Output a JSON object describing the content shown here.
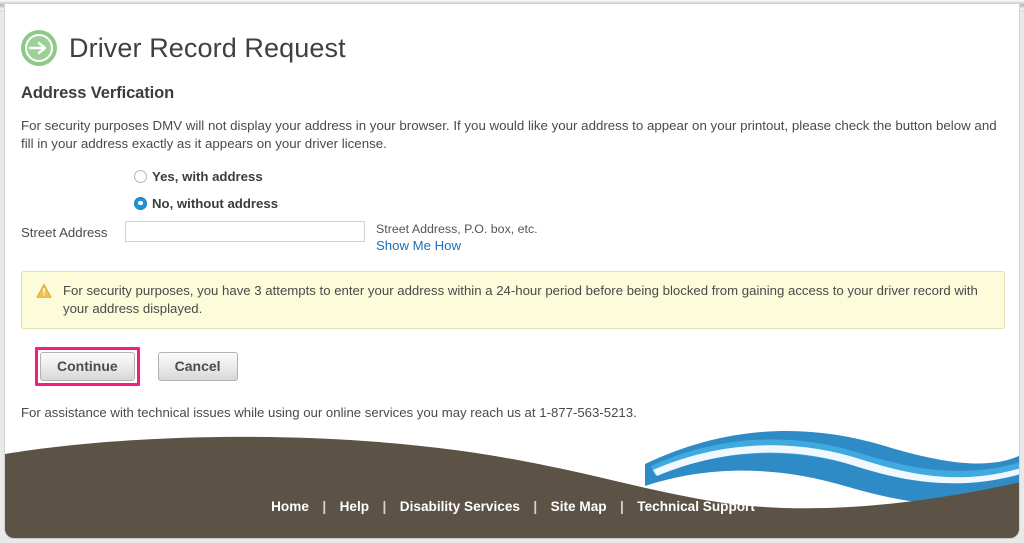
{
  "header": {
    "icon": "green-arrow-circle-icon",
    "title": "Driver Record Request"
  },
  "section": {
    "heading": "Address Verfication",
    "intro": "For security purposes DMV will not display your address in your browser. If you would like your address to appear on your printout, please check the button below and fill in your address exactly as it appears on your driver license."
  },
  "form": {
    "options": [
      {
        "label": "Yes, with address",
        "selected": false
      },
      {
        "label": "No, without address",
        "selected": true
      }
    ],
    "street_address": {
      "label": "Street Address",
      "value": "",
      "placeholder": "",
      "hint": "Street Address, P.O. box, etc.",
      "help_link": "Show Me How"
    }
  },
  "notice": {
    "icon": "warning-triangle-icon",
    "text": "For security purposes, you have 3 attempts to enter your address within a 24-hour period before being blocked from gaining access to your driver record with your address displayed."
  },
  "actions": {
    "continue_label": "Continue",
    "cancel_label": "Cancel",
    "highlight_color": "#f51e7e"
  },
  "assistance": {
    "text": "For assistance with technical issues while using our online services you may reach us at 1-877-563-5213."
  },
  "footer": {
    "links": [
      "Home",
      "Help",
      "Disability Services",
      "Site Map",
      "Technical Support"
    ],
    "separator": "|",
    "land_color": "#5c5346",
    "wave_color_dark": "#2e8bc6",
    "wave_color_light": "#3fa9e0"
  },
  "theme": {
    "accent_green": "#8fc98a",
    "link_blue": "#1e6fb8",
    "radio_blue": "#1e93d6",
    "notice_bg": "#fcfbda"
  }
}
